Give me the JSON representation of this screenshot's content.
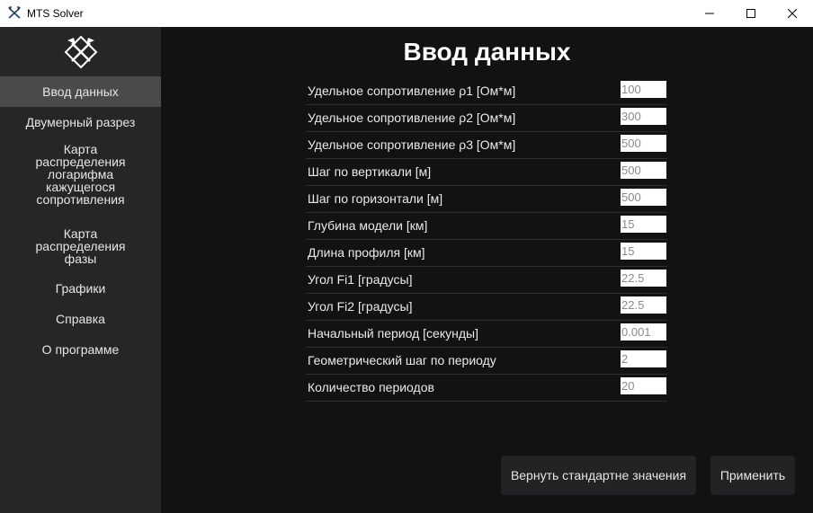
{
  "window": {
    "title": "MTS Solver"
  },
  "sidebar": {
    "items": [
      {
        "label": "Ввод данных"
      },
      {
        "label": "Двумерный разрез"
      },
      {
        "label": "Карта распределения логарифма кажущегося сопротивления"
      },
      {
        "label": "Карта распределения фазы"
      },
      {
        "label": "Графики"
      },
      {
        "label": "Справка"
      },
      {
        "label": "О программе"
      }
    ]
  },
  "main": {
    "title": "Ввод данных",
    "fields": [
      {
        "label": "Удельное сопротивление ρ1 [Ом*м]",
        "value": "100"
      },
      {
        "label": "Удельное сопротивление ρ2 [Ом*м]",
        "value": "300"
      },
      {
        "label": "Удельное сопротивление ρ3 [Ом*м]",
        "value": "500"
      },
      {
        "label": "Шаг по вертикали [м]",
        "value": "500"
      },
      {
        "label": "Шаг по горизонтали [м]",
        "value": "500"
      },
      {
        "label": "Глубина модели [км]",
        "value": "15"
      },
      {
        "label": "Длина профиля [км]",
        "value": "15"
      },
      {
        "label": "Угол Fi1 [градусы]",
        "value": "22.5"
      },
      {
        "label": "Угол Fi2 [градусы]",
        "value": "22.5"
      },
      {
        "label": "Начальный период [секунды]",
        "value": "0.001"
      },
      {
        "label": "Геометрический шаг по периоду",
        "value": "2"
      },
      {
        "label": "Количество периодов",
        "value": "20"
      }
    ],
    "buttons": {
      "reset": "Вернуть стандартне значения",
      "apply": "Применить"
    }
  },
  "colors": {
    "sidebar_bg": "#262628",
    "active_item_bg": "#4a4a4c",
    "main_bg": "#121212",
    "button_bg": "#232325"
  }
}
